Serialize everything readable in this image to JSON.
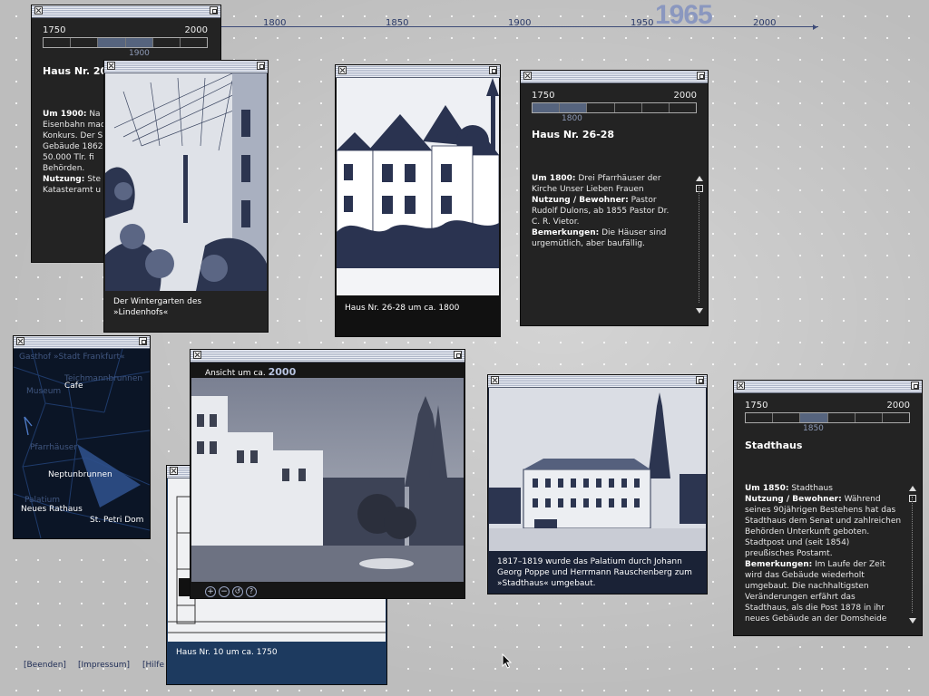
{
  "timeline": {
    "current_year": "1965",
    "labels": [
      "1800",
      "1850",
      "1900",
      "1950",
      "2000"
    ]
  },
  "windows": {
    "haus20": {
      "mini_timeline": {
        "start": "1750",
        "end": "2000",
        "marker": "1900"
      },
      "title": "Haus Nr. 20",
      "lines": [
        {
          "label": "Um 1900:",
          "text": " Na"
        },
        {
          "label": "",
          "text": "Eisenbahn mac"
        },
        {
          "label": "",
          "text": "Konkurs. Der S"
        },
        {
          "label": "",
          "text": "Gebäude 1862"
        },
        {
          "label": "",
          "text": "50.000 Tlr. fi"
        },
        {
          "label": "",
          "text": "Behörden."
        },
        {
          "label": "Nutzung:",
          "text": " Ste"
        },
        {
          "label": "",
          "text": "Katasteramt u"
        }
      ]
    },
    "wintergarten": {
      "caption_lines": [
        "Der Wintergarten des",
        "»Lindenhofs«"
      ]
    },
    "haus26_photo": {
      "caption": "Haus Nr. 26-28 um ca. 1800"
    },
    "haus26_text": {
      "mini_timeline": {
        "start": "1750",
        "end": "2000",
        "marker": "1800"
      },
      "title": "Haus Nr. 26-28",
      "lines": [
        {
          "label": "Um 1800:",
          "text": " Drei Pfarrhäuser der"
        },
        {
          "label": "",
          "text": "Kirche Unser Lieben Frauen"
        },
        {
          "label": "Nutzung / Bewohner:",
          "text": " Pastor"
        },
        {
          "label": "",
          "text": "Rudolf Dulons, ab 1855 Pastor Dr."
        },
        {
          "label": "",
          "text": "C. R. Vietor."
        },
        {
          "label": "Bemerkungen:",
          "text": " Die Häuser sind"
        },
        {
          "label": "",
          "text": "urgemütlich, aber baufällig."
        }
      ]
    },
    "map": {
      "labels": {
        "gasthof": "Gasthof »Stadt Frankfurt«",
        "teichmann": "Teichmannbrunnen",
        "museum": "Museum",
        "cafe": "Cafe",
        "pfarrhaeuser": "Pfarrhäuser",
        "neptunbrunnen": "Neptunbrunnen",
        "palatium": "Palatium",
        "neues_rathaus": "Neues Rathaus",
        "petri_dom": "St. Petri Dom"
      }
    },
    "ansicht": {
      "header_prefix": "Ansicht um ca.",
      "header_year": "2000",
      "controls": [
        "zoom-in",
        "zoom-out",
        "reset",
        "help"
      ]
    },
    "haus10": {
      "caption": "Haus Nr. 10 um ca. 1750"
    },
    "palatium": {
      "caption_lines": [
        "1817–1819 wurde das Palatium durch Johann",
        "Georg Poppe und Herrmann Rauschenberg zum",
        "»Stadthaus« umgebaut."
      ]
    },
    "stadthaus": {
      "mini_timeline": {
        "start": "1750",
        "end": "2000",
        "marker": "1850"
      },
      "title": "Stadthaus",
      "lines": [
        {
          "label": "Um 1850:",
          "text": " Stadthaus"
        },
        {
          "label": "Nutzung / Bewohner:",
          "text": " Während"
        },
        {
          "label": "",
          "text": "seines 90jährigen Bestehens hat das"
        },
        {
          "label": "",
          "text": "Stadthaus dem Senat und zahlreichen"
        },
        {
          "label": "",
          "text": "Behörden Unterkunft geboten."
        },
        {
          "label": "",
          "text": "Stadtpost und (seit 1854)"
        },
        {
          "label": "",
          "text": "preußisches Postamt."
        },
        {
          "label": "Bemerkungen:",
          "text": " Im Laufe der Zeit"
        },
        {
          "label": "",
          "text": "wird das Gebäude wiederholt"
        },
        {
          "label": "",
          "text": "umgebaut. Die nachhaltigsten"
        },
        {
          "label": "",
          "text": "Veränderungen erfährt das"
        },
        {
          "label": "",
          "text": "Stadthaus, als die Post 1878 in ihr"
        },
        {
          "label": "",
          "text": "neues Gebäude an der Domsheide"
        }
      ]
    }
  },
  "footer": {
    "links": [
      "[Beenden]",
      "[Impressum]",
      "[Hilfe"
    ]
  },
  "colors": {
    "window_bg": "#232323",
    "accent": "#56647e",
    "timeline_text": "#2a3966",
    "year_highlight": "#8a97bf"
  }
}
